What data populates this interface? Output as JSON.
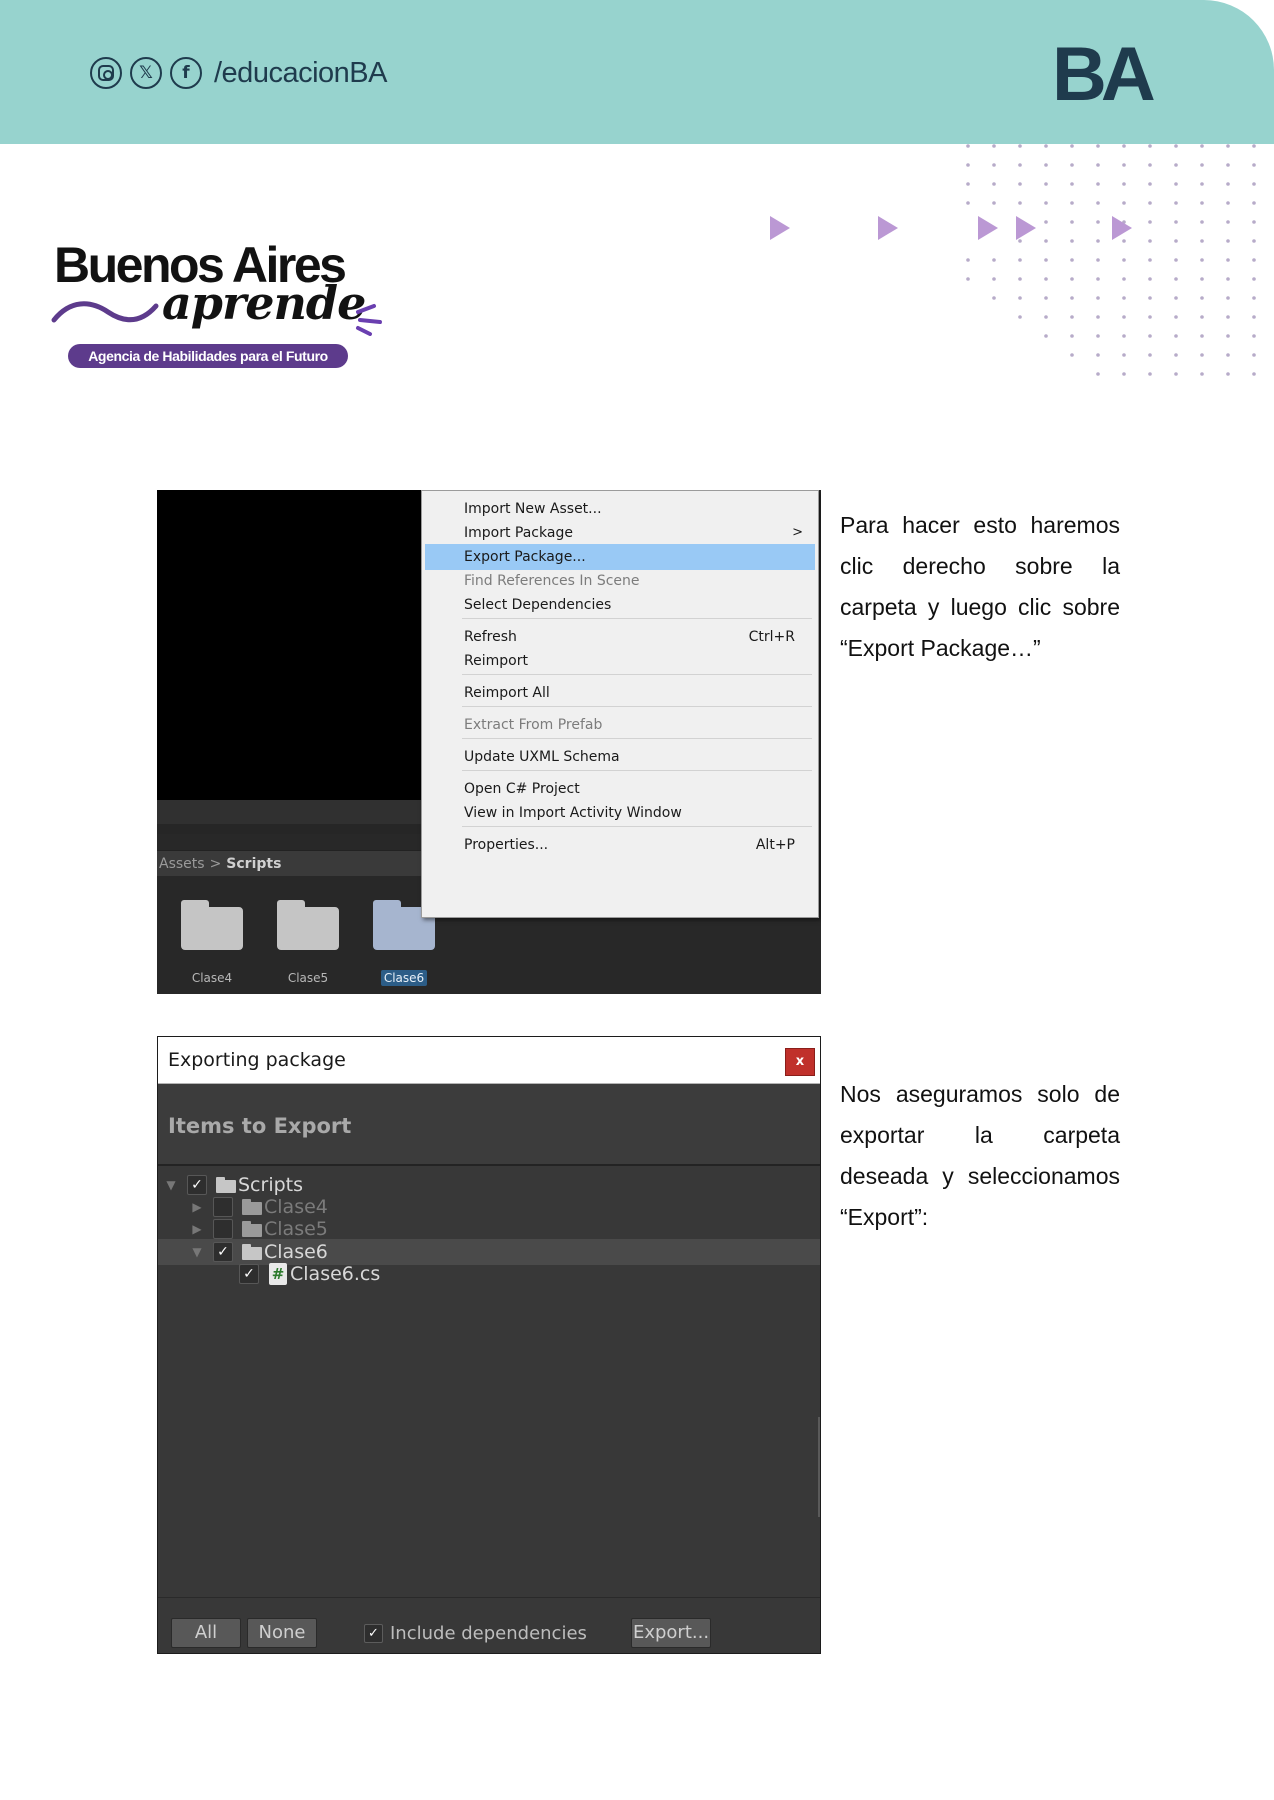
{
  "header": {
    "social_icons": [
      "instagram-icon",
      "x-icon",
      "facebook-icon"
    ],
    "x_glyph": "𝕏",
    "facebook_glyph": "f",
    "handle": "/educacionBA",
    "ba_logo_text": "BA",
    "band_color": "#97d3ce",
    "text_color": "#1f3b4d"
  },
  "brand": {
    "title": "Buenos Aires",
    "subtitle": "aprende",
    "tagline": "Agencia de Habilidades para el Futuro",
    "accent_color": "#5d3b8c"
  },
  "decoration": {
    "arrow_color": "#bb98d4",
    "dot_color": "#b7abc9"
  },
  "screenshot1": {
    "breadcrumb": {
      "root": "Assets",
      "separator": ">",
      "leaf": "Scripts"
    },
    "folders": [
      {
        "label": "Clase4",
        "selected": false
      },
      {
        "label": "Clase5",
        "selected": false
      },
      {
        "label": "Clase6",
        "selected": true
      }
    ],
    "context_menu": {
      "items": [
        {
          "label": "Import New Asset..."
        },
        {
          "label": "Import Package",
          "submenu_arrow": ">"
        },
        {
          "label": "Export Package...",
          "highlighted": true
        },
        {
          "label": "Find References In Scene",
          "disabled": true
        },
        {
          "label": "Select Dependencies"
        },
        {
          "label": "Refresh",
          "shortcut": "Ctrl+R"
        },
        {
          "label": "Reimport"
        },
        {
          "label": "Reimport All"
        },
        {
          "label": "Extract From Prefab",
          "disabled": true
        },
        {
          "label": "Update UXML Schema"
        },
        {
          "label": "Open C# Project"
        },
        {
          "label": "View in Import Activity Window"
        },
        {
          "label": "Properties...",
          "shortcut": "Alt+P"
        }
      ]
    }
  },
  "screenshot2": {
    "window_title": "Exporting package",
    "close_label": "x",
    "section_title": "Items to Export",
    "tree": [
      {
        "label": "Scripts",
        "checked": true,
        "expander": "▼",
        "icon": "folder-icon"
      },
      {
        "label": "Clase4",
        "checked": false,
        "expander": "▶",
        "icon": "folder-icon"
      },
      {
        "label": "Clase5",
        "checked": false,
        "expander": "▶",
        "icon": "folder-icon"
      },
      {
        "label": "Clase6",
        "checked": true,
        "expander": "▼",
        "icon": "folder-icon",
        "selected": true
      },
      {
        "label": "Clase6.cs",
        "checked": true,
        "expander": "",
        "icon": "csharp-script-icon"
      }
    ],
    "script_glyph": "#",
    "footer": {
      "all_label": "All",
      "none_label": "None",
      "include_dependencies_label": "Include dependencies",
      "include_dependencies_checked": true,
      "export_label": "Export..."
    }
  },
  "paragraphs": {
    "p1": "Para hacer esto haremos clic derecho sobre la carpeta y luego clic sobre “Export Package…”",
    "p2": "Nos aseguramos solo de exportar la carpeta deseada y seleccionamos “Export”:"
  }
}
